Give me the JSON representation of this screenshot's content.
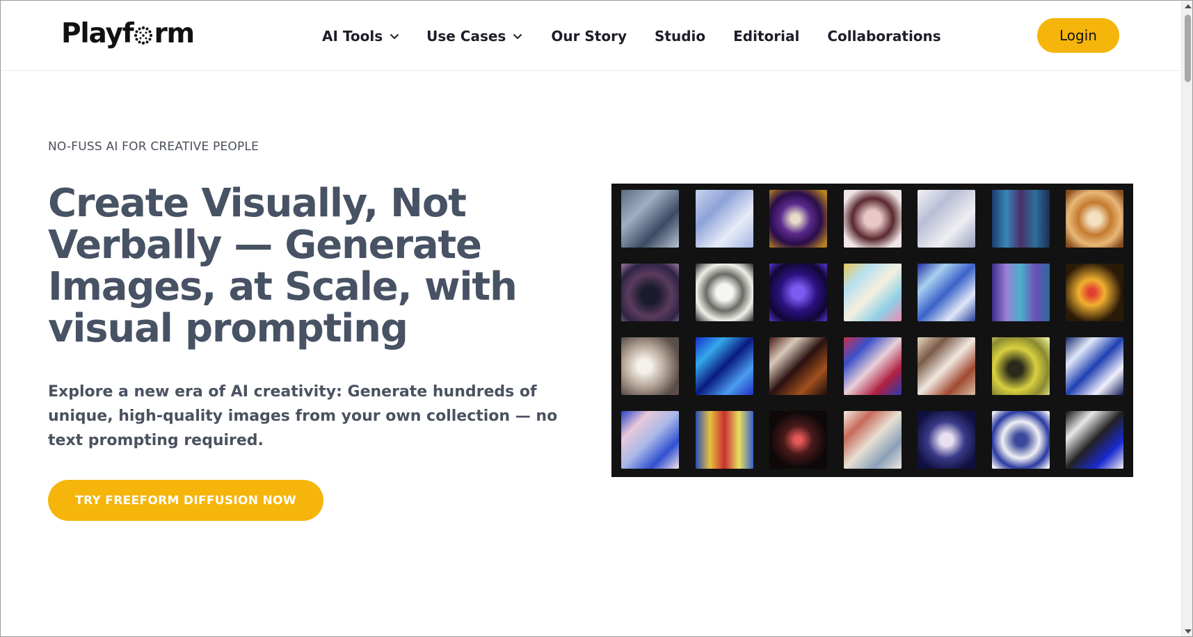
{
  "brand": {
    "name_prefix": "Playf",
    "name_suffix": "rm",
    "logo_icon": "dotted-o-logo"
  },
  "nav": {
    "items": [
      {
        "label": "AI Tools",
        "has_dropdown": true
      },
      {
        "label": "Use Cases",
        "has_dropdown": true
      },
      {
        "label": "Our Story",
        "has_dropdown": false
      },
      {
        "label": "Studio",
        "has_dropdown": false
      },
      {
        "label": "Editorial",
        "has_dropdown": false
      },
      {
        "label": "Collaborations",
        "has_dropdown": false
      }
    ],
    "login_label": "Login"
  },
  "hero": {
    "eyebrow": "NO-FUSS AI FOR CREATIVE PEOPLE",
    "headline": "Create Visually, Not Verbally — Generate Images, at Scale, with visual prompting",
    "subtext": "Explore a new era of AI creativity: Generate hundreds of unique, high-quality images from your own collection — no text prompting required.",
    "cta_label": "TRY FREEFORM DIFFUSION NOW"
  },
  "gallery": {
    "tiles": [
      "linear-gradient(135deg,#5a6b82,#9fb0c4,#3c4a63,#b8c5d3)",
      "linear-gradient(135deg,#c9d4ef,#8ea2d8,#e7ecf8,#a3b4e2)",
      "radial-gradient(circle at 45% 50%,#e6dcc8 10%,#5b2a8e 35%,#2a0d4a 60%,#b6801f 90%)",
      "radial-gradient(circle at 50% 50%,#e8c7c7 20%,#5a2830 50%,#f0e6e6 80%)",
      "linear-gradient(135deg,#f2f2f5,#b9bed6,#eeeef3,#9aa0c0)",
      "linear-gradient(90deg,#1d3b6e,#3a86b8,#4b2f6a,#2d6f9a,#1a2e55)",
      "radial-gradient(circle at 50% 50%,#f4e0c0 15%,#c47a2e 40%,#e8b878 65%,#8a4f1c 90%)",
      "radial-gradient(circle at 50% 55%,#1b1b2e 20%,#5b3b5e 50%,#2e2446 75%,#8a6a8e 95%)",
      "radial-gradient(circle at 50% 50%,#f5f5f2 20%,#6b6b66 45%,#f0f0ea 70%,#444 95%)",
      "radial-gradient(circle at 50% 50%,#7a5cf0 15%,#2a1280 45%,#120633 75%,#4c2fb8 95%)",
      "linear-gradient(135deg,#e6c65a,#b8e0f0,#f5f0e0,#8fd0e6,#f08ab0)",
      "linear-gradient(135deg,#1f2fa0,#a8d0f0,#3a62c8,#e0e8f8,#2a3f9a)",
      "linear-gradient(90deg,#3b2d8a,#9b7fd8,#4ab0c8,#6b4fb8,#2e6a9e)",
      "radial-gradient(circle at 45% 50%,#e04030 8%,#f2b030 30%,#2a1a08 70%)",
      "radial-gradient(circle at 40% 50%,#f4f0ea 15%,#b8a89a 45%,#5a4e48 80%)",
      "linear-gradient(135deg,#1530d0,#35a8e8,#0a1a80,#4a9cf0,#2030c0)",
      "linear-gradient(135deg,#4a1a1a,#d8c8b8,#2a1010,#a0501e,#1a0a0a)",
      "linear-gradient(135deg,#c83050,#3a50c8,#e8d0d8,#b02040,#2a3ab0)",
      "linear-gradient(135deg,#e8d8c0,#7a5a48,#f0e8e0,#a04830,#d8c0a8)",
      "radial-gradient(circle at 40% 55%,#2a2a1a 15%,#d8d040 45%,#8a8a30 70%,#e8e890 95%)",
      "linear-gradient(135deg,#1a2a6e,#e0e8f8,#2040b0,#f0f0ff,#101a50)",
      "linear-gradient(135deg,#2840c8,#e8c8d8,#a8b8e8,#3050d0,#f0e0e8)",
      "linear-gradient(90deg,#2a50b8,#e8c040,#c83030,#e8e060,#3a60c8)",
      "radial-gradient(circle at 50% 50%,#e85a5a 8%,#4a1a1a 35%,#0e0808 70%)",
      "linear-gradient(135deg,#f0ece4,#c86a5a,#e8e0d4,#8aa0b8,#f0e8e0)",
      "radial-gradient(circle at 50% 50%,#e8e0f0 15%,#3a3a8a 45%,#101040 80%)",
      "radial-gradient(circle at 50% 50%,#3a4a9a 15%,#f0f0f4 45%,#2a3aa0 70%,#f4f4f8 95%)",
      "linear-gradient(135deg,#111,#e8e8e8,#222,#1a2ad0,#f0f0f0)"
    ]
  }
}
